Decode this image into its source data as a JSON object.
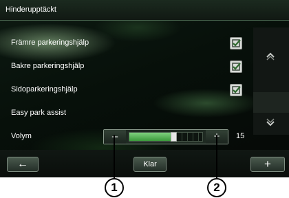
{
  "header": {
    "title": "Hinderupptäckt"
  },
  "settings": [
    {
      "label": "Främre parkeringshjälp",
      "checked": true
    },
    {
      "label": "Bakre parkeringshjälp",
      "checked": true
    },
    {
      "label": "Sidoparkeringshjälp",
      "checked": true
    },
    {
      "label": "Easy park assist",
      "checked": null
    }
  ],
  "volume": {
    "label": "Volym",
    "minus_label": "–",
    "plus_label": "+",
    "value": "15",
    "level_fraction": 0.6
  },
  "scroll": {
    "up_icon": "chevron-up-icon",
    "down_icon": "chevron-down-icon"
  },
  "footer": {
    "back_label": "←",
    "ok_label": "Klar",
    "add_label": "+"
  },
  "callouts": [
    {
      "label": "1"
    },
    {
      "label": "2"
    }
  ],
  "colors": {
    "accent_green": "#4fb24f",
    "background": "#0b0f0c"
  }
}
